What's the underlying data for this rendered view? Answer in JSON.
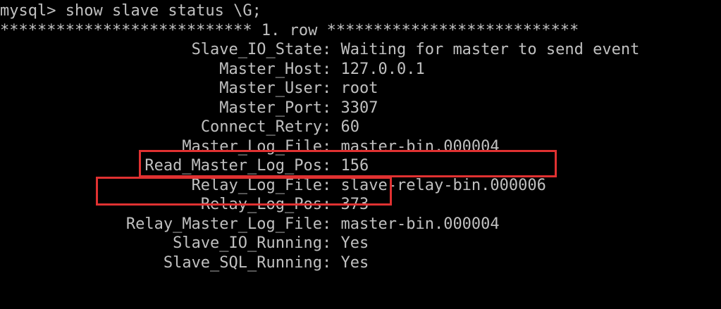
{
  "terminal": {
    "prompt": "mysql>",
    "command": "show slave status \\G;",
    "row_header": "*************************** 1. row ***************************",
    "rows": [
      {
        "key": "Slave_IO_State",
        "value": "Waiting for master to send event"
      },
      {
        "key": "Master_Host",
        "value": "127.0.0.1"
      },
      {
        "key": "Master_User",
        "value": "root"
      },
      {
        "key": "Master_Port",
        "value": "3307"
      },
      {
        "key": "Connect_Retry",
        "value": "60"
      },
      {
        "key": "Master_Log_File",
        "value": "master-bin.000004"
      },
      {
        "key": "Read_Master_Log_Pos",
        "value": "156"
      },
      {
        "key": "Relay_Log_File",
        "value": "slave-relay-bin.000006"
      },
      {
        "key": "Relay_Log_Pos",
        "value": "373"
      },
      {
        "key": "Relay_Master_Log_File",
        "value": "master-bin.000004"
      },
      {
        "key": "Slave_IO_Running",
        "value": "Yes"
      },
      {
        "key": "Slave_SQL_Running",
        "value": "Yes"
      }
    ]
  },
  "colors": {
    "background": "#000000",
    "text": "#c0c0c0",
    "highlight": "#e03131"
  }
}
